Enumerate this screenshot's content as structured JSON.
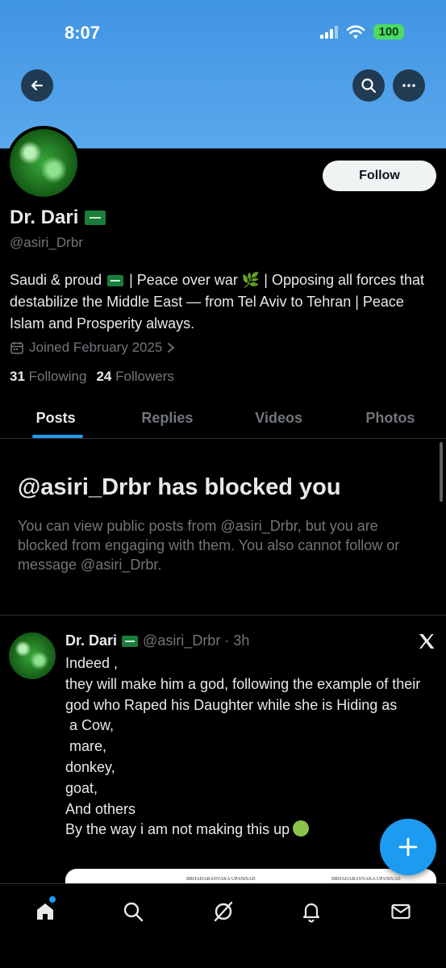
{
  "status_bar": {
    "time": "8:07",
    "battery": "100"
  },
  "header": {
    "back_icon": "arrow-left-icon",
    "search_icon": "search-icon",
    "more_icon": "more-horizontal-icon"
  },
  "profile": {
    "follow_label": "Follow",
    "display_name": "Dr. Dari",
    "handle": "@asiri_Drbr",
    "bio_part1": "Saudi & proud",
    "bio_part2": "| Peace over war 🌿 | Opposing all forces that destabilize the Middle East — from Tel Aviv to Tehran | Peace Islam and Prosperity always.",
    "joined": "Joined February 2025",
    "following_count": "31",
    "following_label": "Following",
    "followers_count": "24",
    "followers_label": "Followers"
  },
  "tabs": [
    "Posts",
    "Replies",
    "Videos",
    "Photos"
  ],
  "blocked": {
    "title": "@asiri_Drbr has blocked you",
    "message": "You can view public posts from @asiri_Drbr, but you are blocked from engaging with them. You also cannot follow or message @asiri_Drbr."
  },
  "post": {
    "author": "Dr. Dari",
    "handle_time": "@asiri_Drbr · 3h",
    "text": "Indeed ,\nthey will make him a god, following the example of their god who Raped his Daughter while she is Hiding as\n a Cow,\n mare,\ndonkey,\ngoat,\nAnd others\nBy the way i am not making this up",
    "image_text_left": "BRHADARANYAKA UPANISAD",
    "image_text_right": "BRHADARANYAKA UPANISAD"
  },
  "fab_icon": "compose-plus-icon",
  "bottom_nav": [
    "home-icon",
    "search-icon",
    "grok-icon",
    "bell-icon",
    "mail-icon"
  ],
  "colors": {
    "accent": "#1d9bf0",
    "banner": "#4a9de6",
    "background": "#000000"
  }
}
